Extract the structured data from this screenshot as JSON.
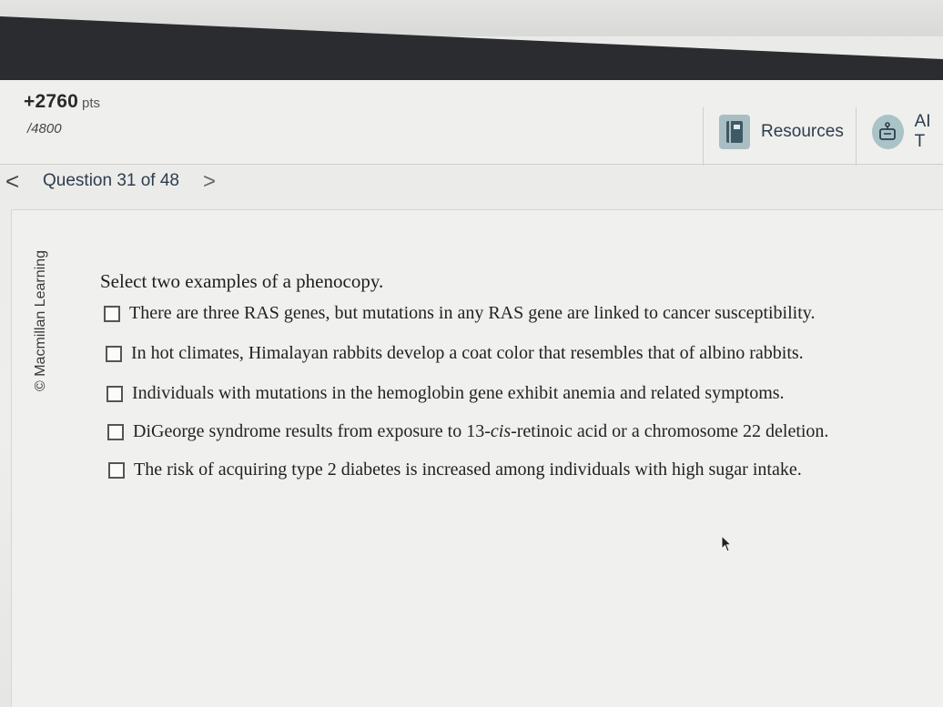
{
  "header": {
    "score": "+2760",
    "score_unit": "pts",
    "total": "/4800",
    "resources_label": "Resources",
    "ai_label": "AI T"
  },
  "nav": {
    "prev_symbol": "<",
    "question_label": "Question 31 of 48",
    "next_symbol": ">"
  },
  "sidebar": {
    "copyright": "© Macmillan Learning"
  },
  "question": {
    "prompt": "Select two examples of a phenocopy.",
    "options": [
      {
        "text": "There are three RAS genes, but mutations in any RAS gene are linked to cancer susceptibility."
      },
      {
        "text": "In hot climates, Himalayan rabbits develop a coat color that resembles that of albino rabbits."
      },
      {
        "text": "Individuals with mutations in the hemoglobin gene exhibit anemia and related symptoms."
      },
      {
        "pre": "DiGeorge syndrome results from exposure to 13-",
        "em": "cis",
        "post": "-retinoic acid or a chromosome 22 deletion."
      },
      {
        "text": "The risk of acquiring type 2 diabetes is increased among individuals with high sugar intake."
      }
    ]
  },
  "colors": {
    "accent_text": "#2d3d4e",
    "icon_bg": "#a9bec3",
    "dark_band": "#2b2c30"
  },
  "icons": {
    "resources": "book-icon",
    "ai": "robot-icon",
    "cursor": "mouse-pointer-icon"
  }
}
